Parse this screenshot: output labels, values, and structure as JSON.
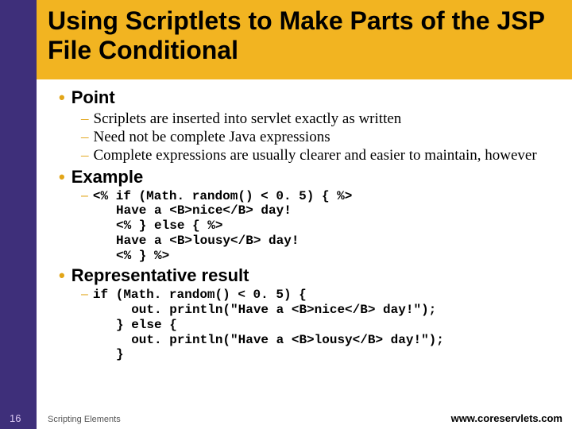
{
  "title": "Using Scriptlets to Make Parts of the JSP File Conditional",
  "sections": [
    {
      "heading": "Point",
      "type": "text",
      "items": [
        "Scriplets are inserted into servlet exactly as written",
        "Need not be complete Java expressions",
        "Complete expressions are usually clearer and easier to maintain, however"
      ]
    },
    {
      "heading": "Example",
      "type": "code",
      "code_first": "<% if (Math. random() < 0. 5) { %>",
      "code_rest": [
        "Have a <B>nice</B> day!",
        "<% } else { %>",
        "Have a <B>lousy</B> day!",
        "<% } %>"
      ]
    },
    {
      "heading": "Representative result",
      "type": "code",
      "code_first": "if (Math. random() < 0. 5) {",
      "code_rest": [
        "  out. println(\"Have a <B>nice</B> day!\");",
        "} else {",
        "  out. println(\"Have a <B>lousy</B> day!\");",
        "}"
      ]
    }
  ],
  "footer": {
    "page": "16",
    "topic": "Scripting Elements",
    "url": "www.coreservlets.com"
  }
}
